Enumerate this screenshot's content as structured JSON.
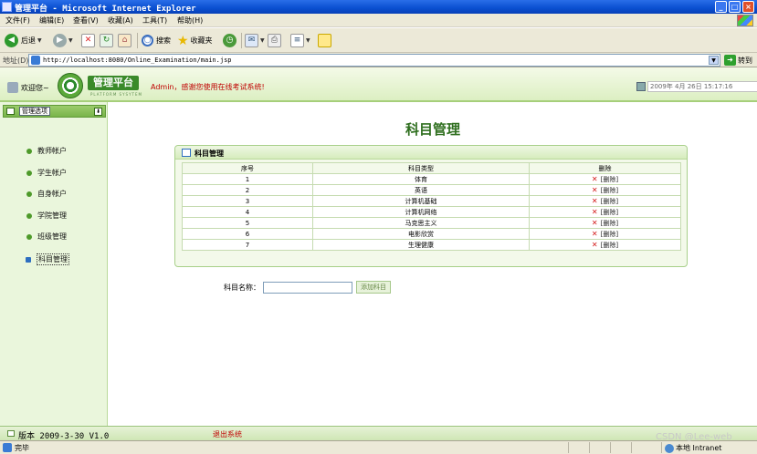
{
  "window": {
    "title": "管理平台 - Microsoft Internet Explorer",
    "buttons": {
      "minimize": "_",
      "maximize": "□",
      "close": "×"
    }
  },
  "menu": [
    "文件(F)",
    "编辑(E)",
    "查看(V)",
    "收藏(A)",
    "工具(T)",
    "帮助(H)"
  ],
  "toolbar": {
    "back": "后退",
    "search": "搜索",
    "favorites": "收藏夹"
  },
  "address": {
    "label": "地址(D)",
    "url": "http://localhost:8080/Online_Examination/main.jsp",
    "go": "转到"
  },
  "header": {
    "welcome": "欢迎您~",
    "logo_title": "管理平台",
    "logo_sub": "PLATFORM SYSYTEM",
    "greeting": "Admin，感谢您使用在线考试系统!",
    "datetime": "2009年 4月 26日 15:17:16"
  },
  "sidebar": {
    "header": "管理选项",
    "toggle": "⬇",
    "items": [
      {
        "label": "教师帐户"
      },
      {
        "label": "学生帐户"
      },
      {
        "label": "自身帐户"
      },
      {
        "label": "学院管理"
      },
      {
        "label": "班级管理"
      },
      {
        "label": "科目管理"
      }
    ]
  },
  "main": {
    "title": "科目管理",
    "panel_title": "科目管理",
    "columns": [
      "序号",
      "科目类型",
      "删除"
    ],
    "rows": [
      {
        "no": "1",
        "type": "体育",
        "del": "[删除]"
      },
      {
        "no": "2",
        "type": "英语",
        "del": "[删除]"
      },
      {
        "no": "3",
        "type": "计算机基础",
        "del": "[删除]"
      },
      {
        "no": "4",
        "type": "计算机网络",
        "del": "[删除]"
      },
      {
        "no": "5",
        "type": "马克思主义",
        "del": "[删除]"
      },
      {
        "no": "6",
        "type": "电影欣赏",
        "del": "[删除]"
      },
      {
        "no": "7",
        "type": "生理健康",
        "del": "[删除]"
      }
    ],
    "form": {
      "label": "科目名称：",
      "value": "",
      "button": "添加科目"
    }
  },
  "footer": {
    "version": "版本 2009-3-30 V1.0",
    "logout": "退出系统"
  },
  "status": {
    "text": "完毕",
    "zone": "本地 Intranet"
  },
  "watermark": "CSDN @Lee-web"
}
